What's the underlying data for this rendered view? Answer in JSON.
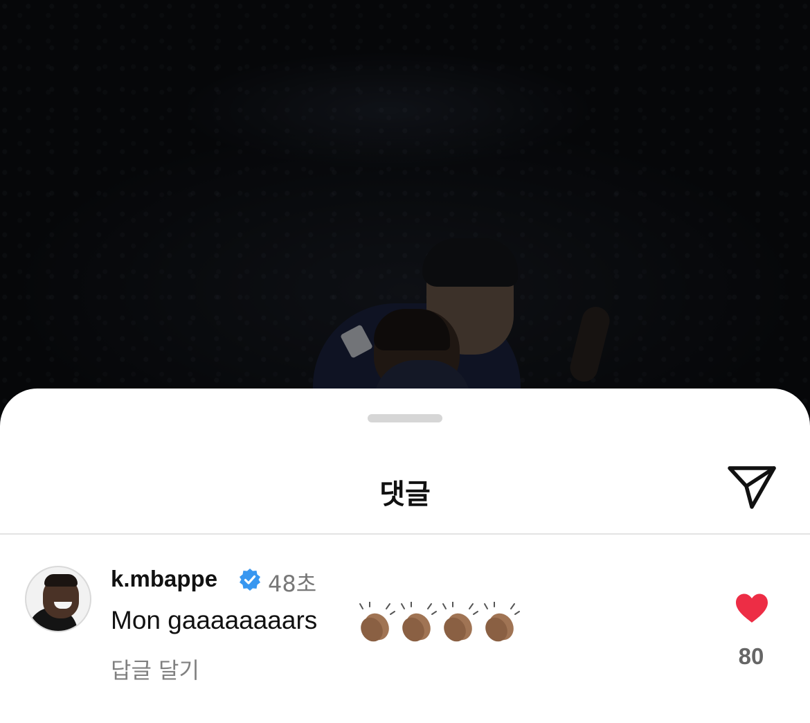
{
  "sheet": {
    "title": "댓글",
    "share_icon": "paper-plane-icon"
  },
  "comment": {
    "username": "k.mbappe",
    "verified_icon": "verified-badge-icon",
    "timestamp": "48초",
    "text": "Mon gaaaaaaaars",
    "emojis": [
      "clapping-hands-icon",
      "clapping-hands-icon",
      "clapping-hands-icon",
      "clapping-hands-icon"
    ],
    "reply_label": "답글 달기",
    "like_icon": "heart-icon",
    "like_count": "80",
    "liked": true
  },
  "colors": {
    "heart": "#ed2d45",
    "verified": "#3897f0",
    "muted_text": "#808080"
  }
}
